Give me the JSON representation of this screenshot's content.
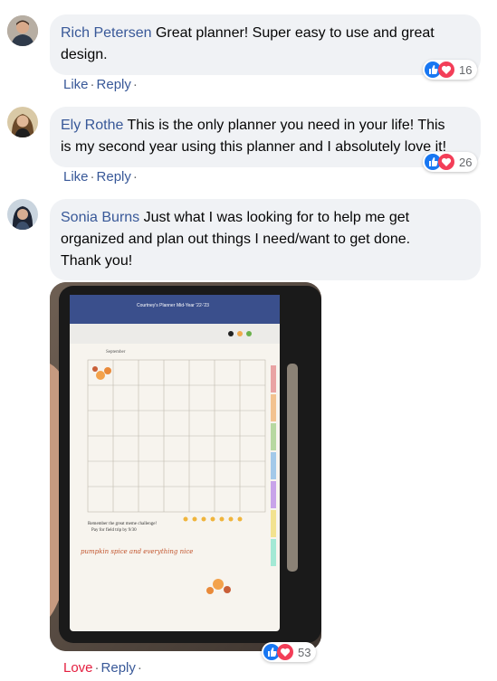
{
  "comments": [
    {
      "author": "Rich Petersen",
      "text_line1": "Great planner! Super easy to use and great",
      "text_line2": "design.",
      "reaction_count": "16",
      "actions": {
        "like": "Like",
        "reply": "Reply"
      }
    },
    {
      "author": "Ely Rothe",
      "text_line1": "This is the only planner you need in your life! This",
      "text_line2": "is my second year using this planner and I absolutely love it!",
      "reaction_count": "26",
      "actions": {
        "like": "Like",
        "reply": "Reply"
      }
    },
    {
      "author": "Sonia Burns",
      "text_line1": "Just what I was looking for to help me get",
      "text_line2": "organized and plan out things I need/want to get done.",
      "text_line3": "Thank you!",
      "reaction_count": "53",
      "actions": {
        "love": "Love",
        "reply": "Reply"
      }
    }
  ],
  "photo": {
    "planner_title": "Courtney's Planner",
    "tab_label": "Mid-Year '22-'23",
    "month": "September",
    "note_line1": "Remember the great meme challenge!",
    "note_line2": "Pay for field trip by 9/30",
    "sticker_text": "pumpkin spice and everything nice"
  },
  "colors": {
    "author": "#385898",
    "bubble": "#f0f2f5",
    "like_blue": "#1877f2",
    "love_red": "#f33e58"
  }
}
